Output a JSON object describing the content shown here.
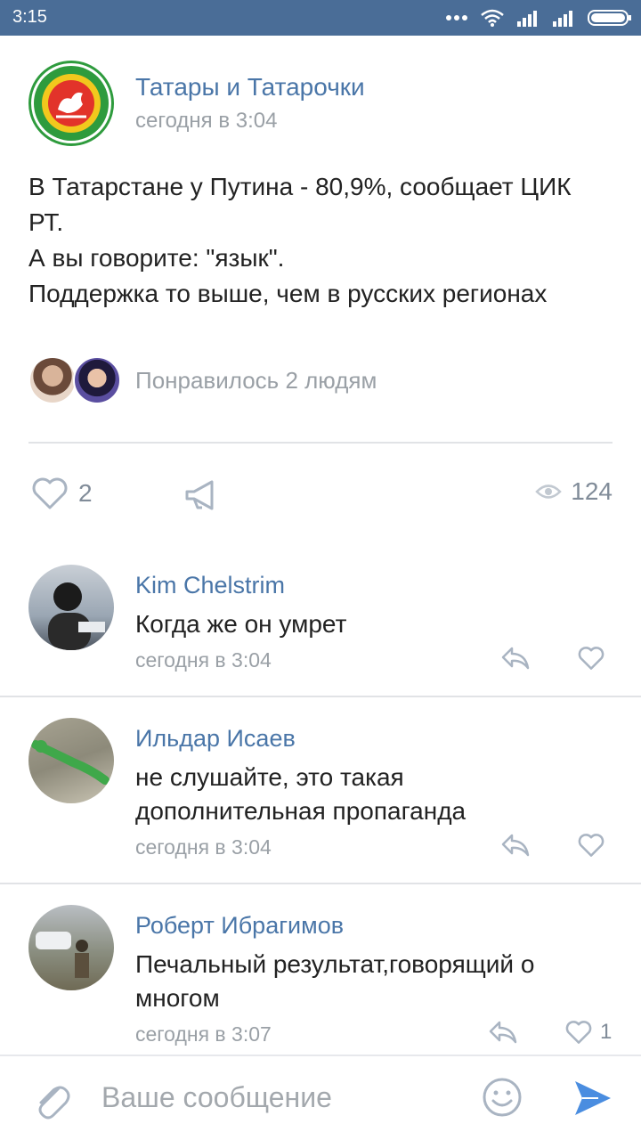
{
  "status_bar": {
    "time": "3:15",
    "icons": [
      "dots-icon",
      "wifi-icon",
      "signal-icon",
      "signal-icon",
      "battery-icon"
    ]
  },
  "post": {
    "group_name": "Татары и Татарочки",
    "time": "сегодня в 3:04",
    "text_lines": [
      "В Татарстане у Путина - 80,9%, сообщает ЦИК",
      "РТ.",
      "А вы говорите: \"язык\".",
      "Поддержка то выше, чем в русских регионах"
    ],
    "liked_by_text": "Понравилось 2 людям",
    "likes_count": "2",
    "views_count": "124"
  },
  "comments": [
    {
      "author": "Kim Chelstrim",
      "text_lines": [
        "Когда же он умрет"
      ],
      "time": "сегодня в 3:04",
      "likes": ""
    },
    {
      "author": "Ильдар Исаев",
      "text_lines": [
        "не слушайте, это такая",
        "дополнительная пропаганда"
      ],
      "time": "сегодня в 3:04",
      "likes": ""
    },
    {
      "author": "Роберт Ибрагимов",
      "text_lines": [
        "Печальный результат,говорящий о",
        "многом"
      ],
      "time": "сегодня в 3:07",
      "likes": "1"
    }
  ],
  "composer": {
    "placeholder": "Ваше сообщение"
  },
  "colors": {
    "status_bar": "#4a6d97",
    "link": "#4a76a8",
    "secondary_text": "#9aa0a6",
    "icon": "#a9b4c2",
    "send": "#4a8de0"
  }
}
